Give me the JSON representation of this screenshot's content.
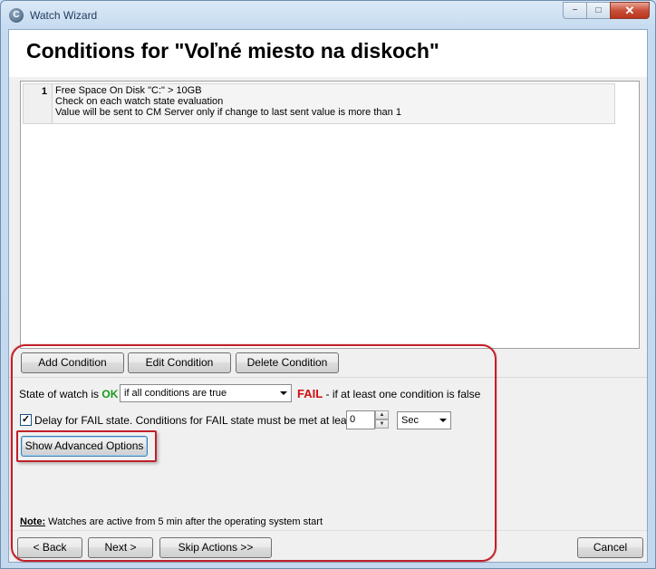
{
  "window": {
    "title": "Watch Wizard",
    "controls": {
      "minimize": "−",
      "maximize": "□",
      "close": "✕"
    }
  },
  "page_title": "Conditions for \"Voľné miesto na diskoch\"",
  "conditions": [
    {
      "number": "1",
      "line1": "Free Space On Disk \"C:\" > 10GB",
      "line2": "Check on each watch state evaluation",
      "line3": "Value will be sent to CM Server only if change to last sent value is more than 1"
    }
  ],
  "condition_buttons": {
    "add": "Add Condition",
    "edit": "Edit Condition",
    "delete": "Delete Condition"
  },
  "state": {
    "prefix": "State of watch is",
    "ok_label": "OK",
    "ok_color": "#1c9a1c",
    "condition_select": "if all conditions are true",
    "fail_label": "FAIL",
    "fail_color": "#d01010",
    "fail_suffix": "- if at least one condition is false"
  },
  "delay": {
    "checked": true,
    "label": "Delay for FAIL state. Conditions for FAIL state must be met at least",
    "value": "0",
    "unit": "Sec"
  },
  "advanced_button": "Show Advanced Options",
  "note": {
    "label": "Note:",
    "text": "Watches are active from 5 min after the operating system start"
  },
  "nav": {
    "back": "< Back",
    "next": "Next >",
    "skip": "Skip Actions >>",
    "cancel": "Cancel"
  },
  "highlight_color": "#c0202a"
}
